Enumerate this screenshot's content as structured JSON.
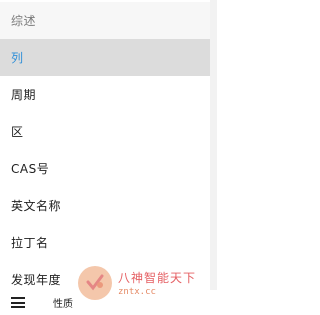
{
  "menu": {
    "items": [
      {
        "label": "综述"
      },
      {
        "label": "列"
      },
      {
        "label": "周期"
      },
      {
        "label": "区"
      },
      {
        "label": "CAS号"
      },
      {
        "label": "英文名称"
      },
      {
        "label": "拉丁名"
      },
      {
        "label": "发现年度"
      }
    ],
    "selected_index": 1
  },
  "bottom_bar": {
    "menu_icon": "hamburger-menu-icon",
    "label": "性质"
  },
  "watermark": {
    "title": "八神智能天下",
    "subtitle": "zntx.cc"
  },
  "colors": {
    "selected_text": "#2f8fd8",
    "selected_bg": "#dcdcdc",
    "header_text": "#7a7a7a",
    "watermark_text": "#e55f63"
  }
}
